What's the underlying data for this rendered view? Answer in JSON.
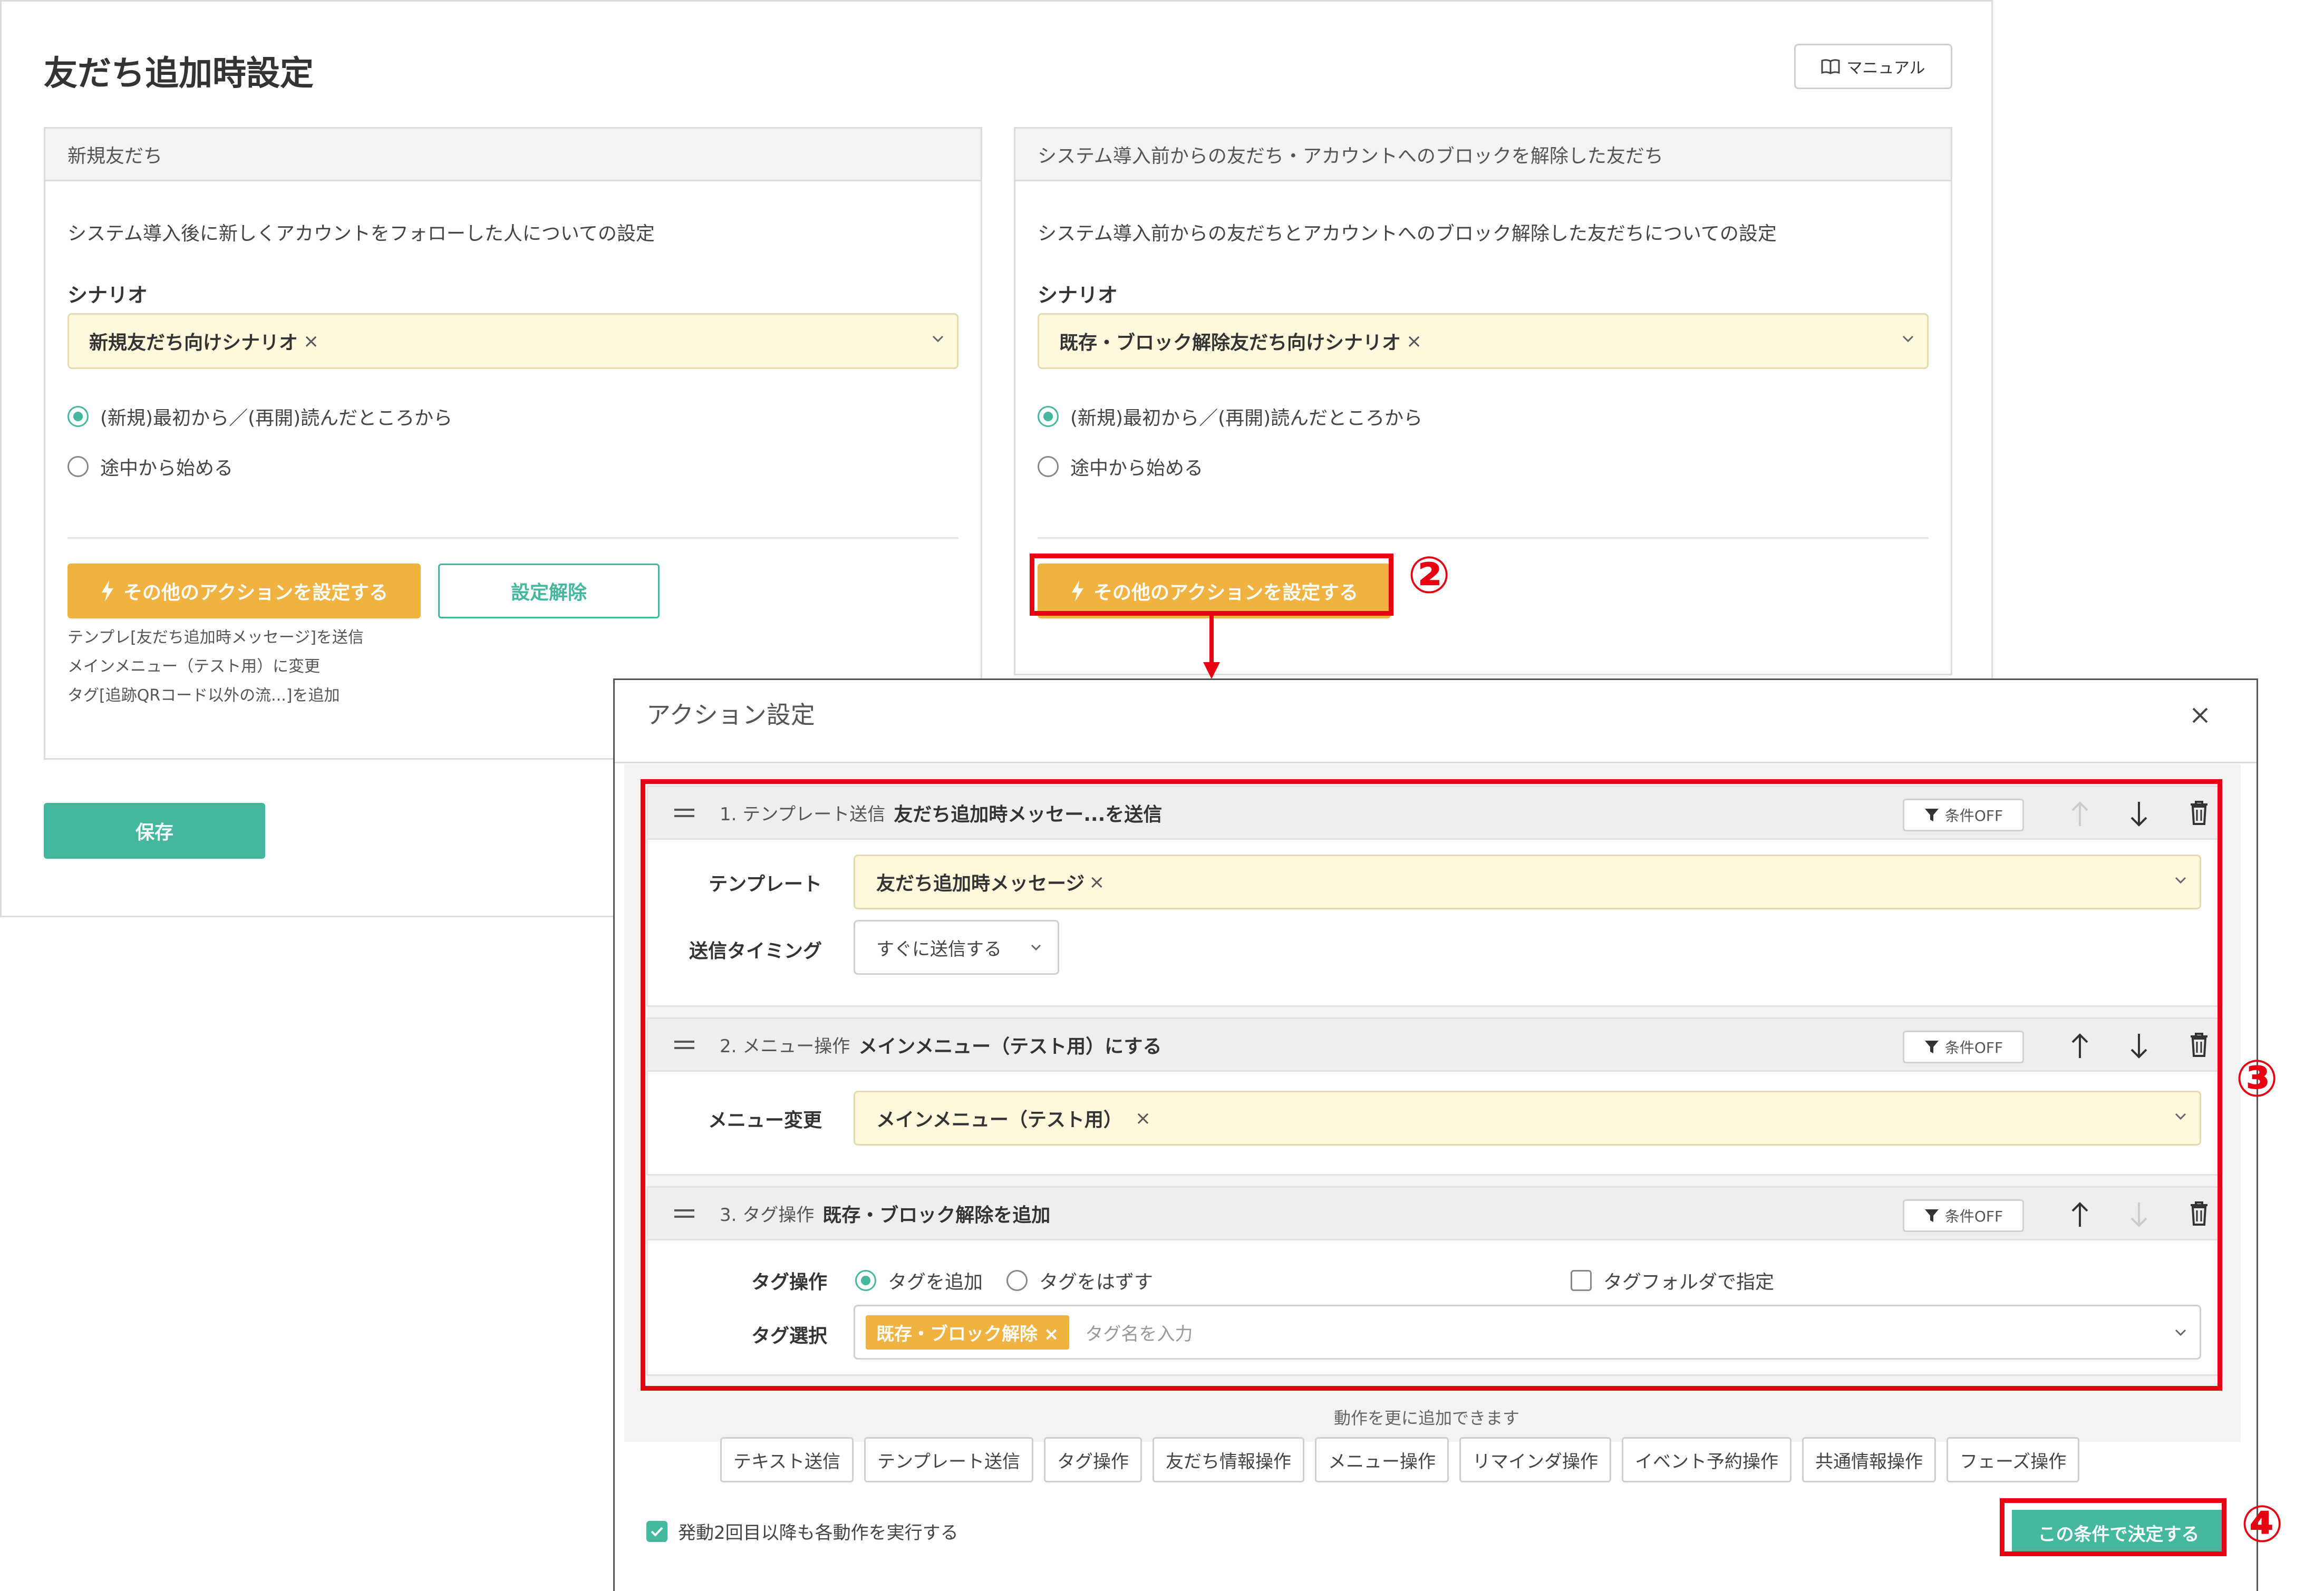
{
  "page": {
    "title": "友だち追加時設定",
    "manual_label": "マニュアル",
    "save_label": "保存"
  },
  "left_panel": {
    "header": "新規友だち",
    "description": "システム導入後に新しくアカウントをフォローした人についての設定",
    "scenario_label": "シナリオ",
    "scenario_value": "新規友だち向けシナリオ",
    "radio_options": [
      "(新規)最初から／(再開)読んだところから",
      "途中から始める"
    ],
    "selected_radio": 0,
    "action_button": "その他のアクションを設定する",
    "clear_button": "設定解除",
    "summary": [
      "テンプレ[友だち追加時メッセージ]を送信",
      "メインメニュー（テスト用）に変更",
      "タグ[追跡QRコード以外の流...]を追加"
    ]
  },
  "right_panel": {
    "header": "システム導入前からの友だち・アカウントへのブロックを解除した友だち",
    "description": "システム導入前からの友だちとアカウントへのブロック解除した友だちについての設定",
    "scenario_label": "シナリオ",
    "scenario_value": "既存・ブロック解除友だち向けシナリオ",
    "radio_options": [
      "(新規)最初から／(再開)読んだところから",
      "途中から始める"
    ],
    "selected_radio": 0,
    "action_button": "その他のアクションを設定する"
  },
  "annotations": {
    "step2": "②",
    "step3": "③",
    "step4": "④"
  },
  "modal": {
    "title": "アクション設定",
    "close_symbol": "×",
    "condition_label": "条件OFF",
    "remove_symbol": "×",
    "actions": [
      {
        "number": "1. テンプレート送信",
        "name": "友だち追加時メッセー...を送信",
        "template_label": "テンプレート",
        "template_value": "友だち追加時メッセージ",
        "timing_label": "送信タイミング",
        "timing_value": "すぐに送信する"
      },
      {
        "number": "2. メニュー操作",
        "name": "メインメニュー（テスト用）にする",
        "menu_label": "メニュー変更",
        "menu_value": "メインメニュー（テスト用）"
      },
      {
        "number": "3. タグ操作",
        "name": "既存・ブロック解除を追加",
        "op_label": "タグ操作",
        "op_options": [
          "タグを追加",
          "タグをはずす"
        ],
        "op_selected": 0,
        "folder_label": "タグフォルダで指定",
        "select_label": "タグ選択",
        "tag_chip": "既存・ブロック解除",
        "tag_placeholder": "タグ名を入力"
      }
    ],
    "add_more_text": "動作を更に追加できます",
    "add_buttons": [
      "テキスト送信",
      "テンプレート送信",
      "タグ操作",
      "友だち情報操作",
      "メニュー操作",
      "リマインダ操作",
      "イベント予約操作",
      "共通情報操作",
      "フェーズ操作"
    ],
    "repeat_label": "発動2回目以降も各動作を実行する",
    "repeat_checked": true,
    "decide_button": "この条件で決定する"
  },
  "colors": {
    "accent_green": "#43b89e",
    "accent_orange": "#f0b342",
    "annotation_red": "#e60012",
    "select_fill": "#fff8dc"
  }
}
